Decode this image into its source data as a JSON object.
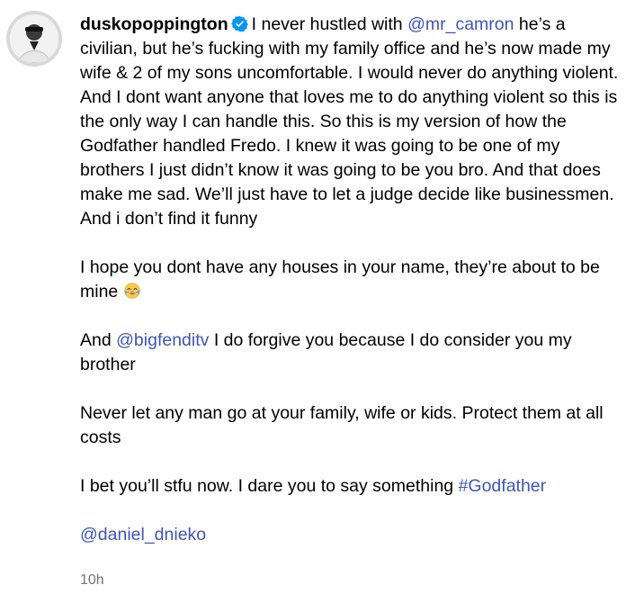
{
  "post": {
    "username": "duskopoppington",
    "verified": true,
    "caption": {
      "p1": [
        {
          "type": "text",
          "text": "I never hustled with "
        },
        {
          "type": "mention",
          "text": "@mr_camron"
        },
        {
          "type": "text",
          "text": " he’s a civilian, but he’s fucking with my family office and he’s now made my wife & 2 of my sons uncomfortable. I would never do anything violent. And I dont want anyone that loves me to do anything violent so this is the only way I can handle this. So this is my version of how the Godfather handled Fredo. I knew it was going to be one of my brothers I just didn’t know it was going to be you bro. And that does make me sad. We’ll just have to let a judge decide like businessmen. And i don’t find it funny"
        }
      ],
      "p2_text": "I hope you dont have any houses in your name, they’re about to be mine",
      "p2_emoji": "laughing-tears-emoji",
      "p3_prefix": "And ",
      "p3_mention": "@bigfenditv",
      "p3_suffix": " I do forgive you because I do consider you my brother",
      "p4": "Never let any man go at your family, wife or kids. Protect them at all costs",
      "p5_text": "I bet you’ll stfu now. I dare you to say something ",
      "p5_hashtag": "#Godfather",
      "tag": "@daniel_dnieko"
    },
    "timestamp": "10h"
  },
  "colors": {
    "link": "#3d55b8",
    "verified": "#0095f6",
    "timestamp": "#737373"
  },
  "icons": {
    "avatar": "profile-avatar",
    "verified": "verified-badge-icon"
  }
}
